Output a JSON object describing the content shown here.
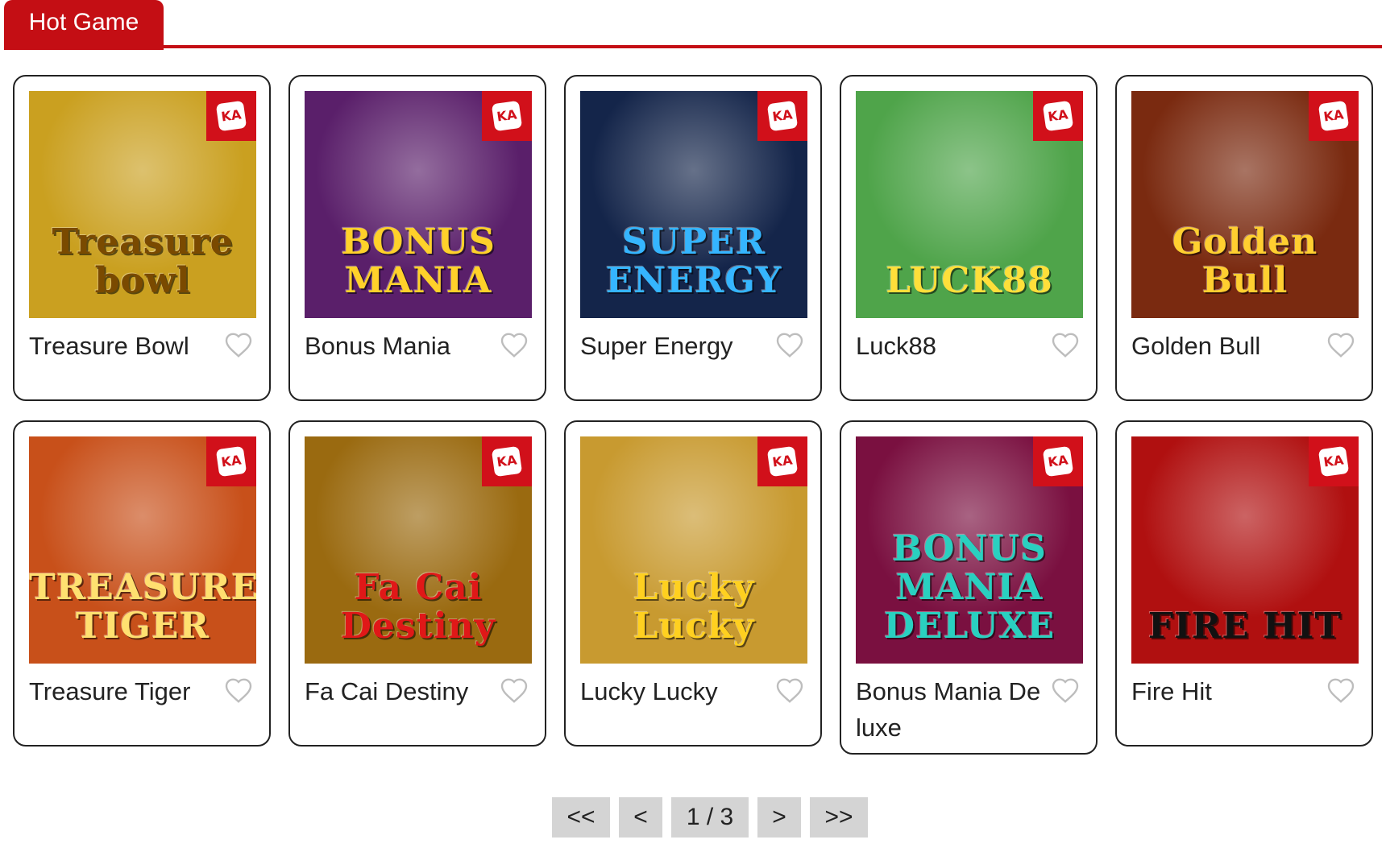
{
  "header": {
    "tab_label": "Hot Game"
  },
  "colors": {
    "accent": "#c40e14",
    "card_border": "#222222",
    "pager_bg": "#d4d4d4"
  },
  "provider_badge": "KA",
  "games": [
    {
      "name": "Treasure Bowl",
      "art_title": "Treasure bowl",
      "bg": "#caa020",
      "fg": "#7a4a00"
    },
    {
      "name": "Bonus Mania",
      "art_title": "BONUS MANIA",
      "bg": "#5a1f6a",
      "fg": "#ffd12a"
    },
    {
      "name": "Super Energy",
      "art_title": "SUPER ENERGY",
      "bg": "#14254a",
      "fg": "#35b5ff"
    },
    {
      "name": "Luck88",
      "art_title": "LUCK88",
      "bg": "#4fa44a",
      "fg": "#ffdf3a"
    },
    {
      "name": "Golden Bull",
      "art_title": "Golden Bull",
      "bg": "#7a2a10",
      "fg": "#ffcf30"
    },
    {
      "name": "Treasure Tiger",
      "art_title": "TREASURE TIGER",
      "bg": "#c8501a",
      "fg": "#ffe070"
    },
    {
      "name": "Fa Cai Destiny",
      "art_title": "Fa Cai Destiny",
      "bg": "#9a6a10",
      "fg": "#e01818"
    },
    {
      "name": "Lucky Lucky",
      "art_title": "Lucky Lucky",
      "bg": "#c89a30",
      "fg": "#ffd020"
    },
    {
      "name": "Bonus Mania Deluxe",
      "art_title": "BONUS MANIA DELUXE",
      "bg": "#7a1040",
      "fg": "#2ad0c0"
    },
    {
      "name": "Fire Hit",
      "art_title": "FIRE HIT",
      "bg": "#b01010",
      "fg": "#111111"
    }
  ],
  "pagination": {
    "first": "<<",
    "prev": "<",
    "current": "1 / 3",
    "next": ">",
    "last": ">>"
  }
}
